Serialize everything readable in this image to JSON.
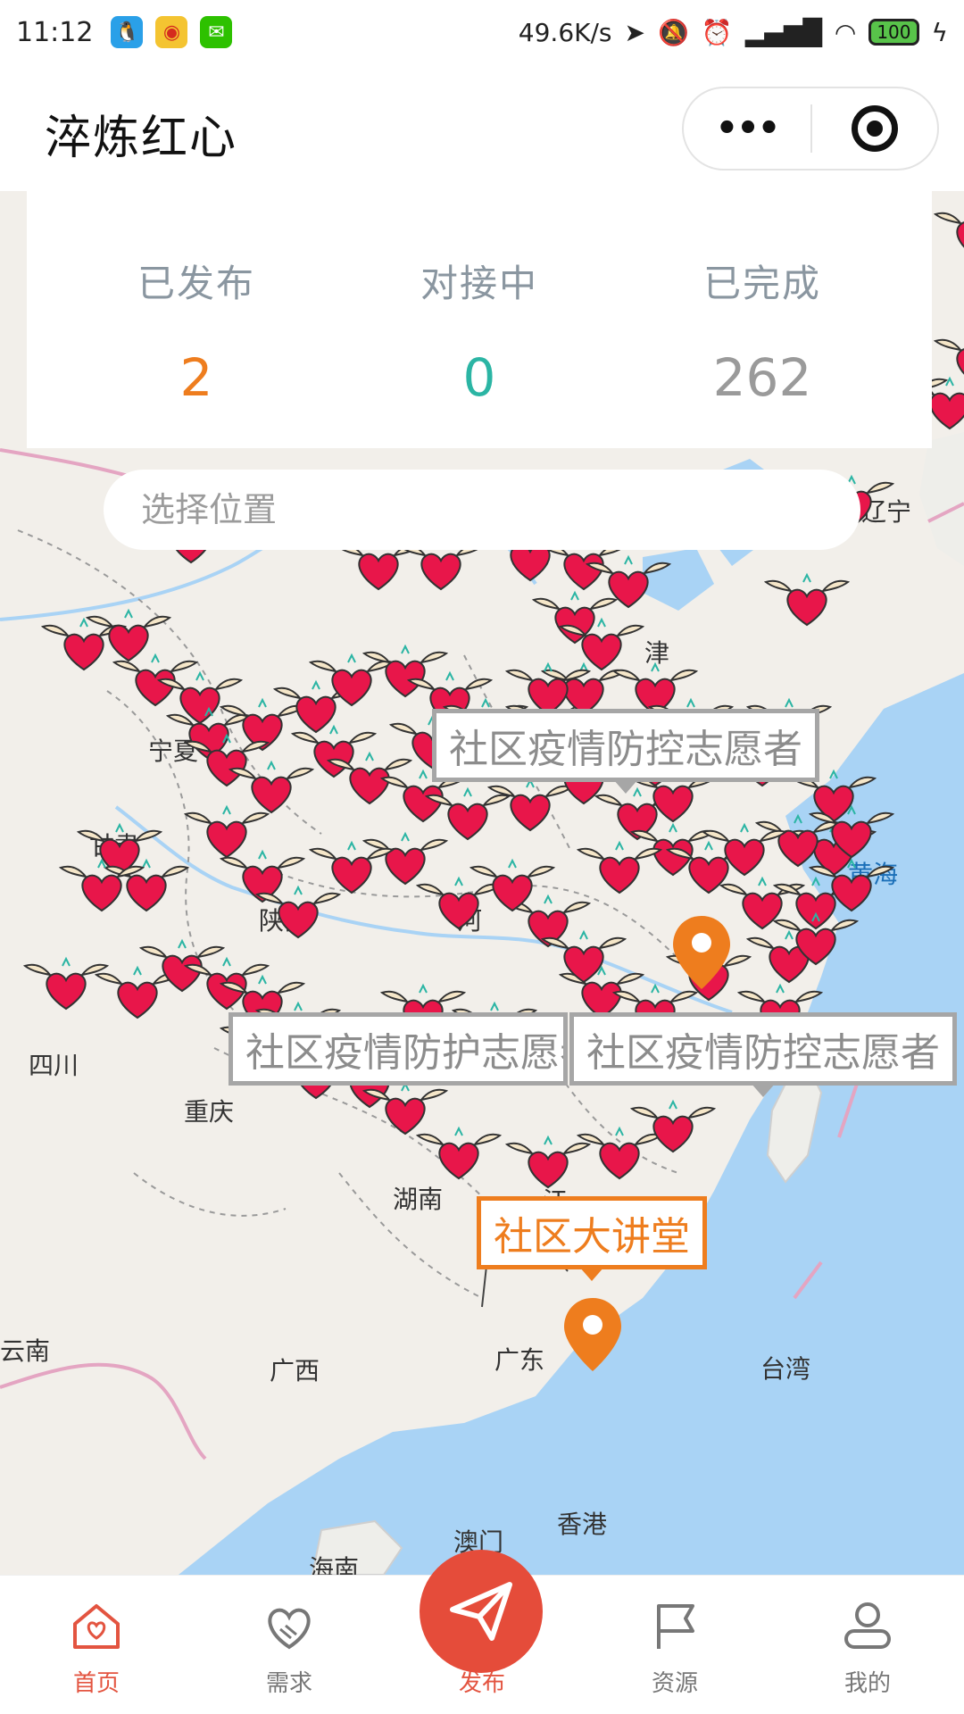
{
  "status_bar": {
    "time": "11:12",
    "network_speed": "49.6K/s",
    "battery": "100"
  },
  "titlebar": {
    "title": "淬炼红心"
  },
  "stats": [
    {
      "label": "已发布",
      "value": "2",
      "color": "#ee7d1e"
    },
    {
      "label": "对接中",
      "value": "0",
      "color": "#2bb5a4"
    },
    {
      "label": "已完成",
      "value": "262",
      "color": "#999999"
    }
  ],
  "search": {
    "placeholder": "选择位置"
  },
  "map": {
    "places": [
      "辽宁",
      "津",
      "宁夏",
      "甘肃",
      "陕西",
      "河",
      "四川",
      "重庆",
      "湖南",
      "江",
      "黄海",
      "云南",
      "广西",
      "广东",
      "台湾",
      "香港",
      "澳门",
      "海南"
    ],
    "callouts": [
      {
        "text": "社区疫情防控志愿者"
      },
      {
        "text": "社区疫情防护志愿者"
      },
      {
        "text": "社区疫情防控志愿者"
      },
      {
        "text": "社区大讲堂"
      }
    ]
  },
  "tabbar": {
    "items": [
      {
        "label": "首页",
        "icon": "home-heart-icon"
      },
      {
        "label": "需求",
        "icon": "handshake-heart-icon"
      },
      {
        "label": "发布",
        "icon": "paper-plane-icon"
      },
      {
        "label": "资源",
        "icon": "flag-icon"
      },
      {
        "label": "我的",
        "icon": "user-icon"
      }
    ]
  },
  "colors": {
    "accent": "#e54c3a",
    "orange": "#ee7d1e",
    "teal": "#2bb5a4",
    "heart": "#e8164a",
    "sea": "#a9d3f5"
  }
}
